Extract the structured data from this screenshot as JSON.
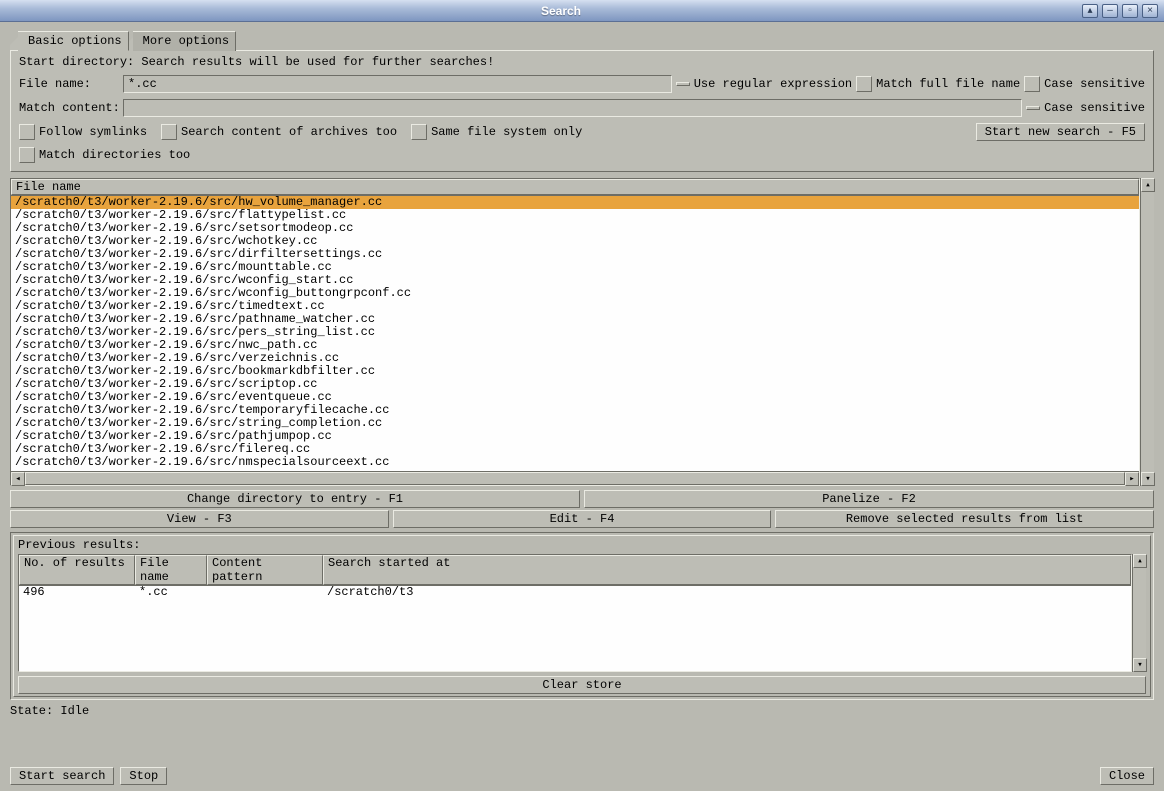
{
  "window": {
    "title": "Search"
  },
  "tabs": {
    "basic": "Basic options",
    "more": "More options"
  },
  "options": {
    "start_dir_label": "Start directory: Search results will be used for further searches!",
    "file_name_label": "File name:",
    "file_name_value": "*.cc",
    "use_regex_label": "Use regular expression",
    "match_full_label": "Match full file name",
    "case_sensitive_label": "Case sensitive",
    "match_content_label": "Match content:",
    "match_content_value": "",
    "case_sensitive2_label": "Case sensitive",
    "follow_symlinks_label": "Follow symlinks",
    "search_archives_label": "Search content of archives too",
    "same_fs_label": "Same file system only",
    "start_new_search_label": "Start new search - F5",
    "match_dirs_label": "Match directories too"
  },
  "results": {
    "header": "File name",
    "rows": [
      "/scratch0/t3/worker-2.19.6/src/hw_volume_manager.cc",
      "/scratch0/t3/worker-2.19.6/src/flattypelist.cc",
      "/scratch0/t3/worker-2.19.6/src/setsortmodeop.cc",
      "/scratch0/t3/worker-2.19.6/src/wchotkey.cc",
      "/scratch0/t3/worker-2.19.6/src/dirfiltersettings.cc",
      "/scratch0/t3/worker-2.19.6/src/mounttable.cc",
      "/scratch0/t3/worker-2.19.6/src/wconfig_start.cc",
      "/scratch0/t3/worker-2.19.6/src/wconfig_buttongrpconf.cc",
      "/scratch0/t3/worker-2.19.6/src/timedtext.cc",
      "/scratch0/t3/worker-2.19.6/src/pathname_watcher.cc",
      "/scratch0/t3/worker-2.19.6/src/pers_string_list.cc",
      "/scratch0/t3/worker-2.19.6/src/nwc_path.cc",
      "/scratch0/t3/worker-2.19.6/src/verzeichnis.cc",
      "/scratch0/t3/worker-2.19.6/src/bookmarkdbfilter.cc",
      "/scratch0/t3/worker-2.19.6/src/scriptop.cc",
      "/scratch0/t3/worker-2.19.6/src/eventqueue.cc",
      "/scratch0/t3/worker-2.19.6/src/temporaryfilecache.cc",
      "/scratch0/t3/worker-2.19.6/src/string_completion.cc",
      "/scratch0/t3/worker-2.19.6/src/pathjumpop.cc",
      "/scratch0/t3/worker-2.19.6/src/filereq.cc",
      "/scratch0/t3/worker-2.19.6/src/nmspecialsourceext.cc"
    ]
  },
  "actions": {
    "change_dir": "Change directory to entry - F1",
    "panelize": "Panelize - F2",
    "view": "View - F3",
    "edit": "Edit - F4",
    "remove": "Remove selected results from list"
  },
  "previous": {
    "title": "Previous results:",
    "headers": {
      "count": "No. of results",
      "file": "File name",
      "content": "Content pattern",
      "started": "Search started at"
    },
    "row": {
      "count": "496",
      "file": "*.cc",
      "content": "",
      "started": "/scratch0/t3"
    },
    "clear_store": "Clear store"
  },
  "state": {
    "label": "State: Idle"
  },
  "footer": {
    "start": "Start search",
    "stop": "Stop",
    "close": "Close"
  }
}
